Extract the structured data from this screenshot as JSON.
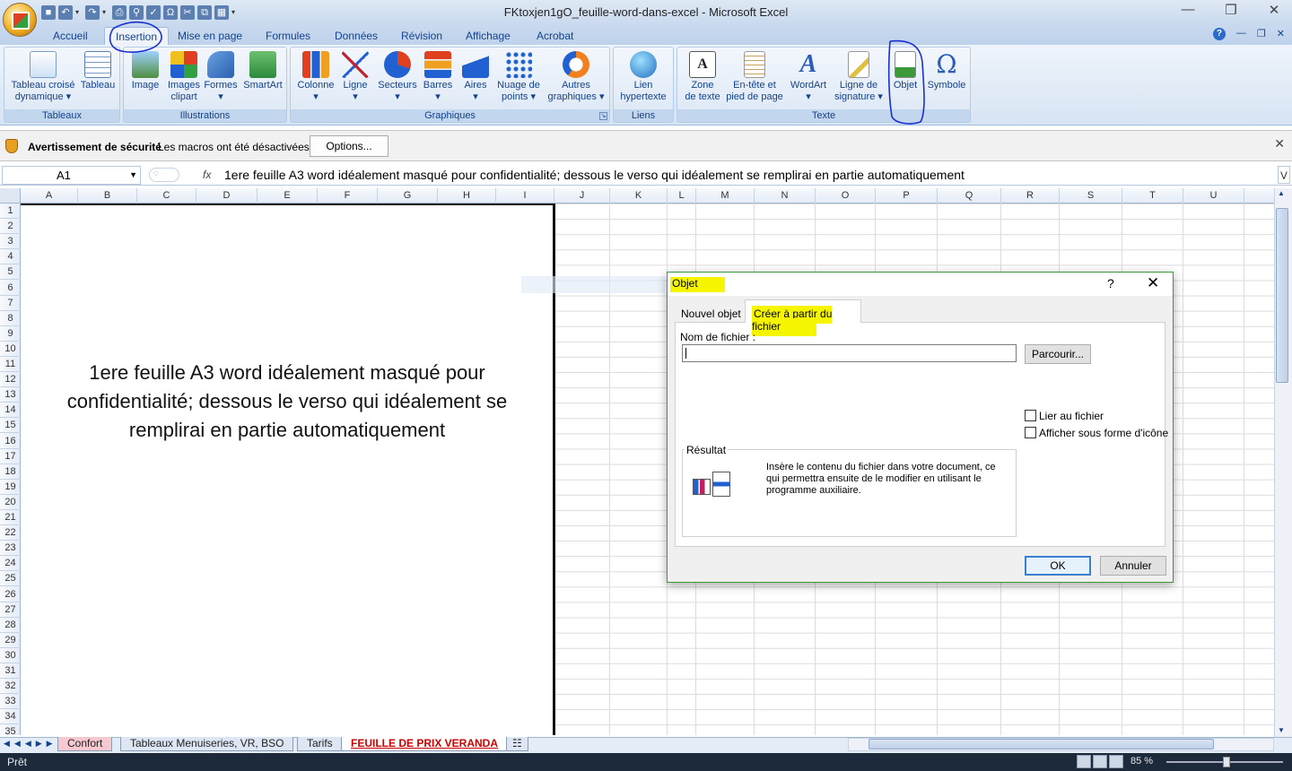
{
  "window": {
    "title": "FKtoxjen1gO_feuille-word-dans-excel - Microsoft Excel",
    "controls": [
      "—",
      "❒",
      "✕"
    ]
  },
  "quick_access": [
    "save-icon",
    "undo-icon",
    "redo-icon",
    "print-icon",
    "print-preview-icon",
    "spelling-icon",
    "omega-icon",
    "cut-icon",
    "copy-icon",
    "paste-icon"
  ],
  "ribbon": {
    "tabs": [
      {
        "label": "Accueil"
      },
      {
        "label": "Insertion"
      },
      {
        "label": "Mise en page"
      },
      {
        "label": "Formules"
      },
      {
        "label": "Données"
      },
      {
        "label": "Révision"
      },
      {
        "label": "Affichage"
      },
      {
        "label": "Acrobat"
      }
    ],
    "groups": {
      "tableaux": {
        "label": "Tableaux",
        "buttons": [
          "Tableau croisé\ndynamique ▾",
          "Tableau"
        ]
      },
      "illustrations": {
        "label": "Illustrations",
        "buttons": [
          "Image",
          "Images\nclipart",
          "Formes\n▾",
          "SmartArt"
        ]
      },
      "graphiques": {
        "label": "Graphiques",
        "buttons": [
          "Colonne\n▾",
          "Ligne\n▾",
          "Secteurs\n▾",
          "Barres\n▾",
          "Aires\n▾",
          "Nuage de\npoints ▾",
          "Autres\ngraphiques ▾"
        ]
      },
      "liens": {
        "label": "Liens",
        "buttons": [
          "Lien\nhypertexte"
        ]
      },
      "texte": {
        "label": "Texte",
        "buttons": [
          "Zone\nde texte",
          "En-tête et\npied de page",
          "WordArt\n▾",
          "Ligne de\nsignature ▾",
          "Objet",
          "Symbole"
        ]
      }
    }
  },
  "security": {
    "title": "Avertissement de sécurité",
    "message": "Les macros ont été désactivées.",
    "options_label": "Options..."
  },
  "formula_bar": {
    "cell_ref": "A1",
    "fx": "fx",
    "content": "1ere feuille A3 word idéalement masqué pour confidentialité; dessous le verso qui idéalement se remplirai en partie automatiquement"
  },
  "grid": {
    "columns": [
      "A",
      "B",
      "C",
      "D",
      "E",
      "F",
      "G",
      "H",
      "I",
      "J",
      "K",
      "L",
      "M",
      "N",
      "O",
      "P",
      "Q",
      "R",
      "S",
      "T",
      "U"
    ],
    "rows": [
      "1",
      "2",
      "3",
      "4",
      "5",
      "6",
      "7",
      "8",
      "9",
      "10",
      "11",
      "12",
      "13",
      "14",
      "15",
      "16",
      "17",
      "18",
      "19",
      "20",
      "21",
      "22",
      "23",
      "24",
      "25",
      "26",
      "27",
      "28",
      "29",
      "30",
      "31",
      "32",
      "33",
      "34",
      "35"
    ]
  },
  "embedded_word": {
    "text": "1ere feuille A3 word idéalement masqué pour confidentialité; dessous le verso qui idéalement se remplirai en partie automatiquement"
  },
  "sheet_tabs": [
    {
      "label": "Confort"
    },
    {
      "label": "Tableaux Menuiseries, VR, BSO"
    },
    {
      "label": "Tarifs"
    },
    {
      "label": "FEUILLE DE PRIX VERANDA"
    }
  ],
  "status": {
    "ready": "Prêt",
    "zoom": "85 %"
  },
  "dialog": {
    "title": "Objet",
    "help": "?",
    "close": "✕",
    "tab_new": "Nouvel objet",
    "tab_file": "Créer à partir du fichier",
    "file_label": "Nom de fichier :",
    "file_value": "",
    "browse_label": "Parcourir...",
    "link_label": "Lier au fichier",
    "link_checked": false,
    "icon_label": "Afficher sous forme d'icône",
    "icon_checked": false,
    "result_label": "Résultat",
    "result_text": "Insère le contenu du fichier dans votre document, ce qui permettra ensuite de le modifier en utilisant le programme auxiliaire.",
    "ok_label": "OK",
    "cancel_label": "Annuler"
  },
  "colors": {
    "ribbon_text": "#15428b",
    "highlight": "#f5f500",
    "pen": "#1a2fd0",
    "dialog_border": "#3a9a3a"
  }
}
